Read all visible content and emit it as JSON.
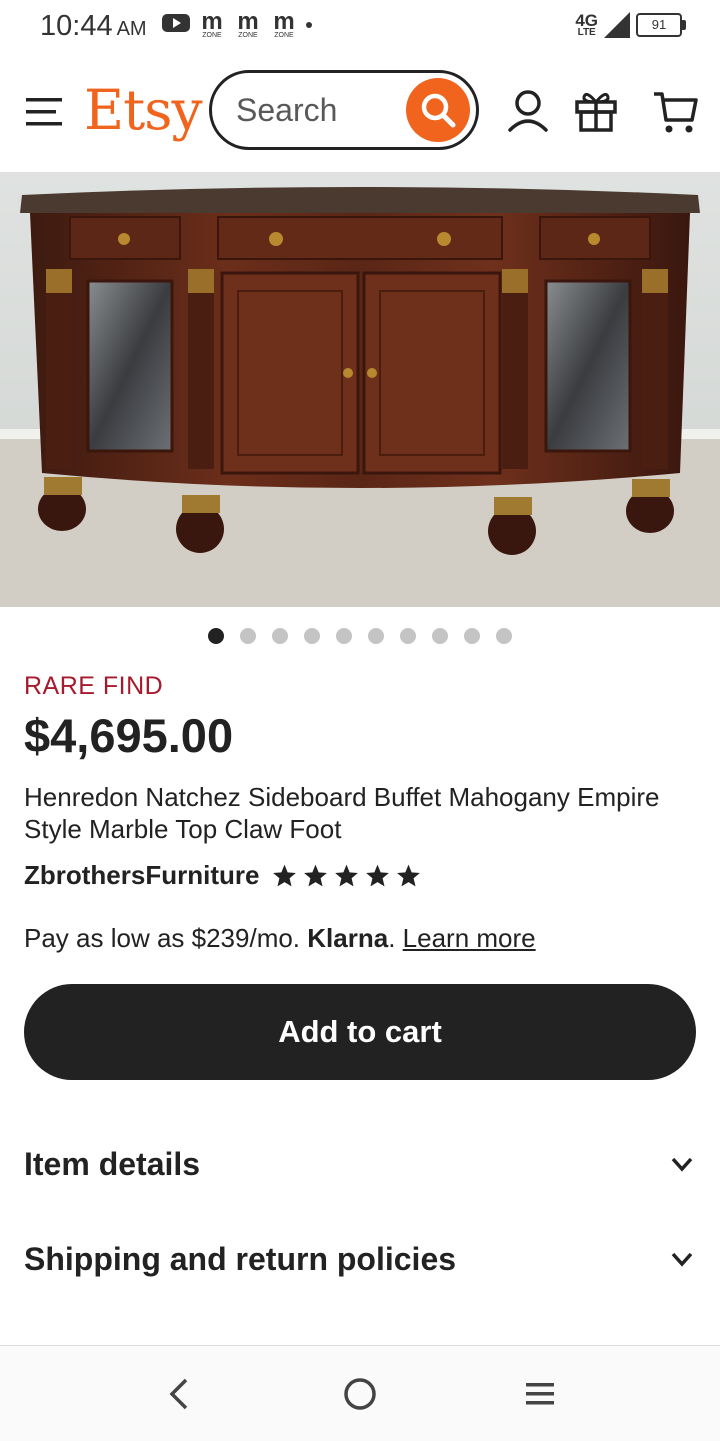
{
  "status_bar": {
    "time": "10:44",
    "ampm": "AM",
    "notification_labels": [
      "m",
      "m",
      "m"
    ],
    "notification_sublabel": "ZONE",
    "network": "4G",
    "network_sub": "LTE",
    "battery": "91"
  },
  "header": {
    "logo": "Etsy",
    "search_placeholder": "Search",
    "brand_color": "#F1641E"
  },
  "gallery": {
    "image_count": 10,
    "active_index": 0
  },
  "product": {
    "badge": "RARE FIND",
    "price": "$4,695.00",
    "title": "Henredon Natchez Sideboard Buffet Mahogany Empire Style Marble Top Claw Foot",
    "shop_name": "ZbrothersFurniture",
    "rating_stars": 5,
    "klarna_prefix": "Pay as low as $239/mo.",
    "klarna_brand": "Klarna",
    "klarna_suffix": ".",
    "learn_more": "Learn more",
    "add_to_cart": "Add to cart"
  },
  "accordions": [
    {
      "label": "Item details"
    },
    {
      "label": "Shipping and return policies"
    }
  ],
  "icons": {
    "menu": "hamburger-icon",
    "search": "search-icon",
    "account": "user-icon",
    "gift": "gift-icon",
    "cart": "cart-icon",
    "expand": "chevron-down-icon",
    "back": "back-icon",
    "home": "home-icon",
    "recents": "recents-icon"
  }
}
